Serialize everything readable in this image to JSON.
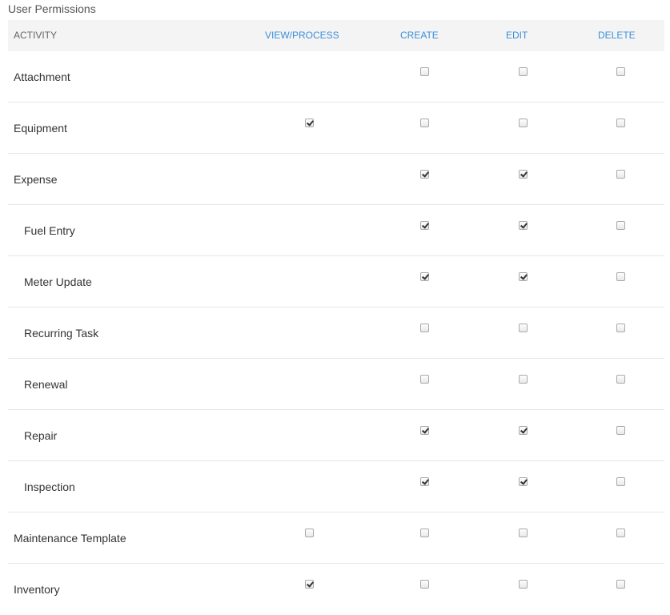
{
  "page": {
    "title": "User Permissions"
  },
  "columns": {
    "activity": "ACTIVITY",
    "view": "VIEW/PROCESS",
    "create": "CREATE",
    "edit": "EDIT",
    "delete": "DELETE"
  },
  "rows": [
    {
      "label": "Attachment",
      "sub": false,
      "view": null,
      "create": false,
      "edit": false,
      "delete": false
    },
    {
      "label": "Equipment",
      "sub": false,
      "view": true,
      "create": false,
      "edit": false,
      "delete": false
    },
    {
      "label": "Expense",
      "sub": false,
      "view": null,
      "create": true,
      "edit": true,
      "delete": false
    },
    {
      "label": "Fuel Entry",
      "sub": true,
      "view": null,
      "create": true,
      "edit": true,
      "delete": false
    },
    {
      "label": "Meter Update",
      "sub": true,
      "view": null,
      "create": true,
      "edit": true,
      "delete": false
    },
    {
      "label": "Recurring Task",
      "sub": true,
      "view": null,
      "create": false,
      "edit": false,
      "delete": false
    },
    {
      "label": "Renewal",
      "sub": true,
      "view": null,
      "create": false,
      "edit": false,
      "delete": false
    },
    {
      "label": "Repair",
      "sub": true,
      "view": null,
      "create": true,
      "edit": true,
      "delete": false
    },
    {
      "label": "Inspection",
      "sub": true,
      "view": null,
      "create": true,
      "edit": true,
      "delete": false
    },
    {
      "label": "Maintenance Template",
      "sub": false,
      "view": false,
      "create": false,
      "edit": false,
      "delete": false
    },
    {
      "label": "Inventory",
      "sub": false,
      "view": true,
      "create": false,
      "edit": false,
      "delete": false
    }
  ],
  "colors": {
    "header_accent": "#3b8fd9",
    "header_background": "#f4f4f4",
    "row_divider": "#e6e6e6"
  }
}
